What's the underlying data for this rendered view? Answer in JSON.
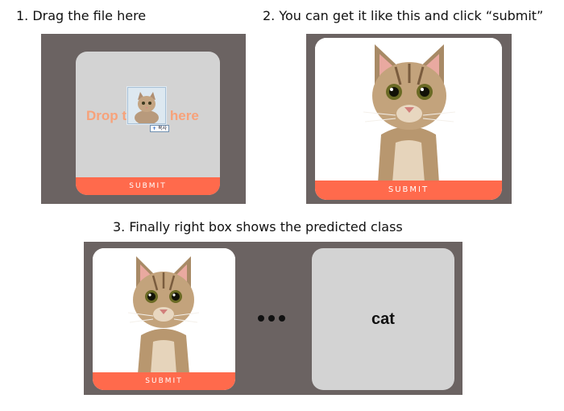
{
  "step1": {
    "caption": "1. Drag the file here",
    "drop_text": "Drop the file here",
    "copy_label": "복사",
    "submit_label": "SUBMIT"
  },
  "step2": {
    "caption": "2. You can get it like this and click “submit”",
    "submit_label": "SUBMIT"
  },
  "step3": {
    "caption": "3. Finally right box shows the predicted class",
    "submit_label": "SUBMIT",
    "prediction": "cat"
  },
  "colors": {
    "panel_bg": "#6b6362",
    "card_gray": "#d3d3d3",
    "submit_bg": "#ff6a4c",
    "drop_text": "#f7a27a"
  }
}
